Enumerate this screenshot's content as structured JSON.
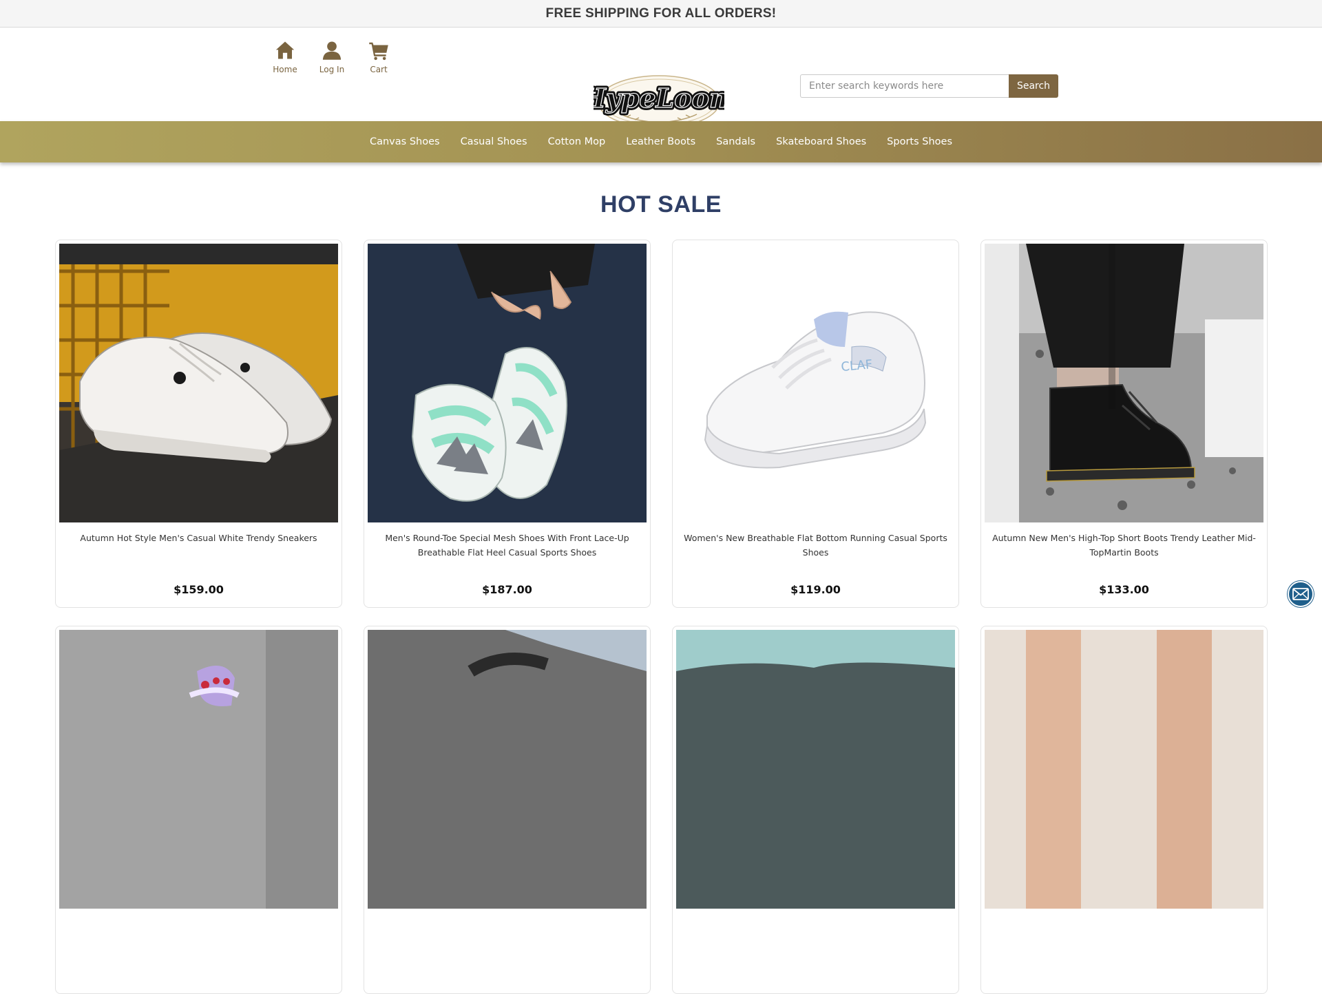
{
  "announcement": "FREE SHIPPING FOR ALL ORDERS!",
  "quicklinks": [
    {
      "label": "Home",
      "icon": "home-icon"
    },
    {
      "label": "Log In",
      "icon": "user-icon"
    },
    {
      "label": "Cart",
      "icon": "cart-icon"
    }
  ],
  "brand": {
    "logo_text": "HypeLoom"
  },
  "search": {
    "placeholder": "Enter search keywords here",
    "button_label": "Search"
  },
  "nav": [
    "Canvas Shoes",
    "Casual Shoes",
    "Cotton Mop",
    "Leather Boots",
    "Sandals",
    "Skateboard Shoes",
    "Sports Shoes"
  ],
  "section_title": "HOT SALE",
  "products": [
    {
      "title": "Autumn Hot Style Men's Casual White Trendy Sneakers",
      "price": "$159.00"
    },
    {
      "title": "Men's Round-Toe Special Mesh Shoes With Front Lace-Up Breathable Flat Heel Casual Sports Shoes",
      "price": "$187.00"
    },
    {
      "title": "Women's New Breathable Flat Bottom Running Casual Sports Shoes",
      "price": "$119.00"
    },
    {
      "title": "Autumn New Men's High-Top Short Boots Trendy Leather Mid-TopMartin Boots",
      "price": "$133.00"
    }
  ],
  "colors": {
    "accent": "#7e6641",
    "nav_start": "#b0a45e",
    "nav_end": "#8a7046",
    "title": "#2f3f66",
    "mail_fab": "#1f5f8b"
  },
  "floating": {
    "icon": "mail-icon"
  }
}
